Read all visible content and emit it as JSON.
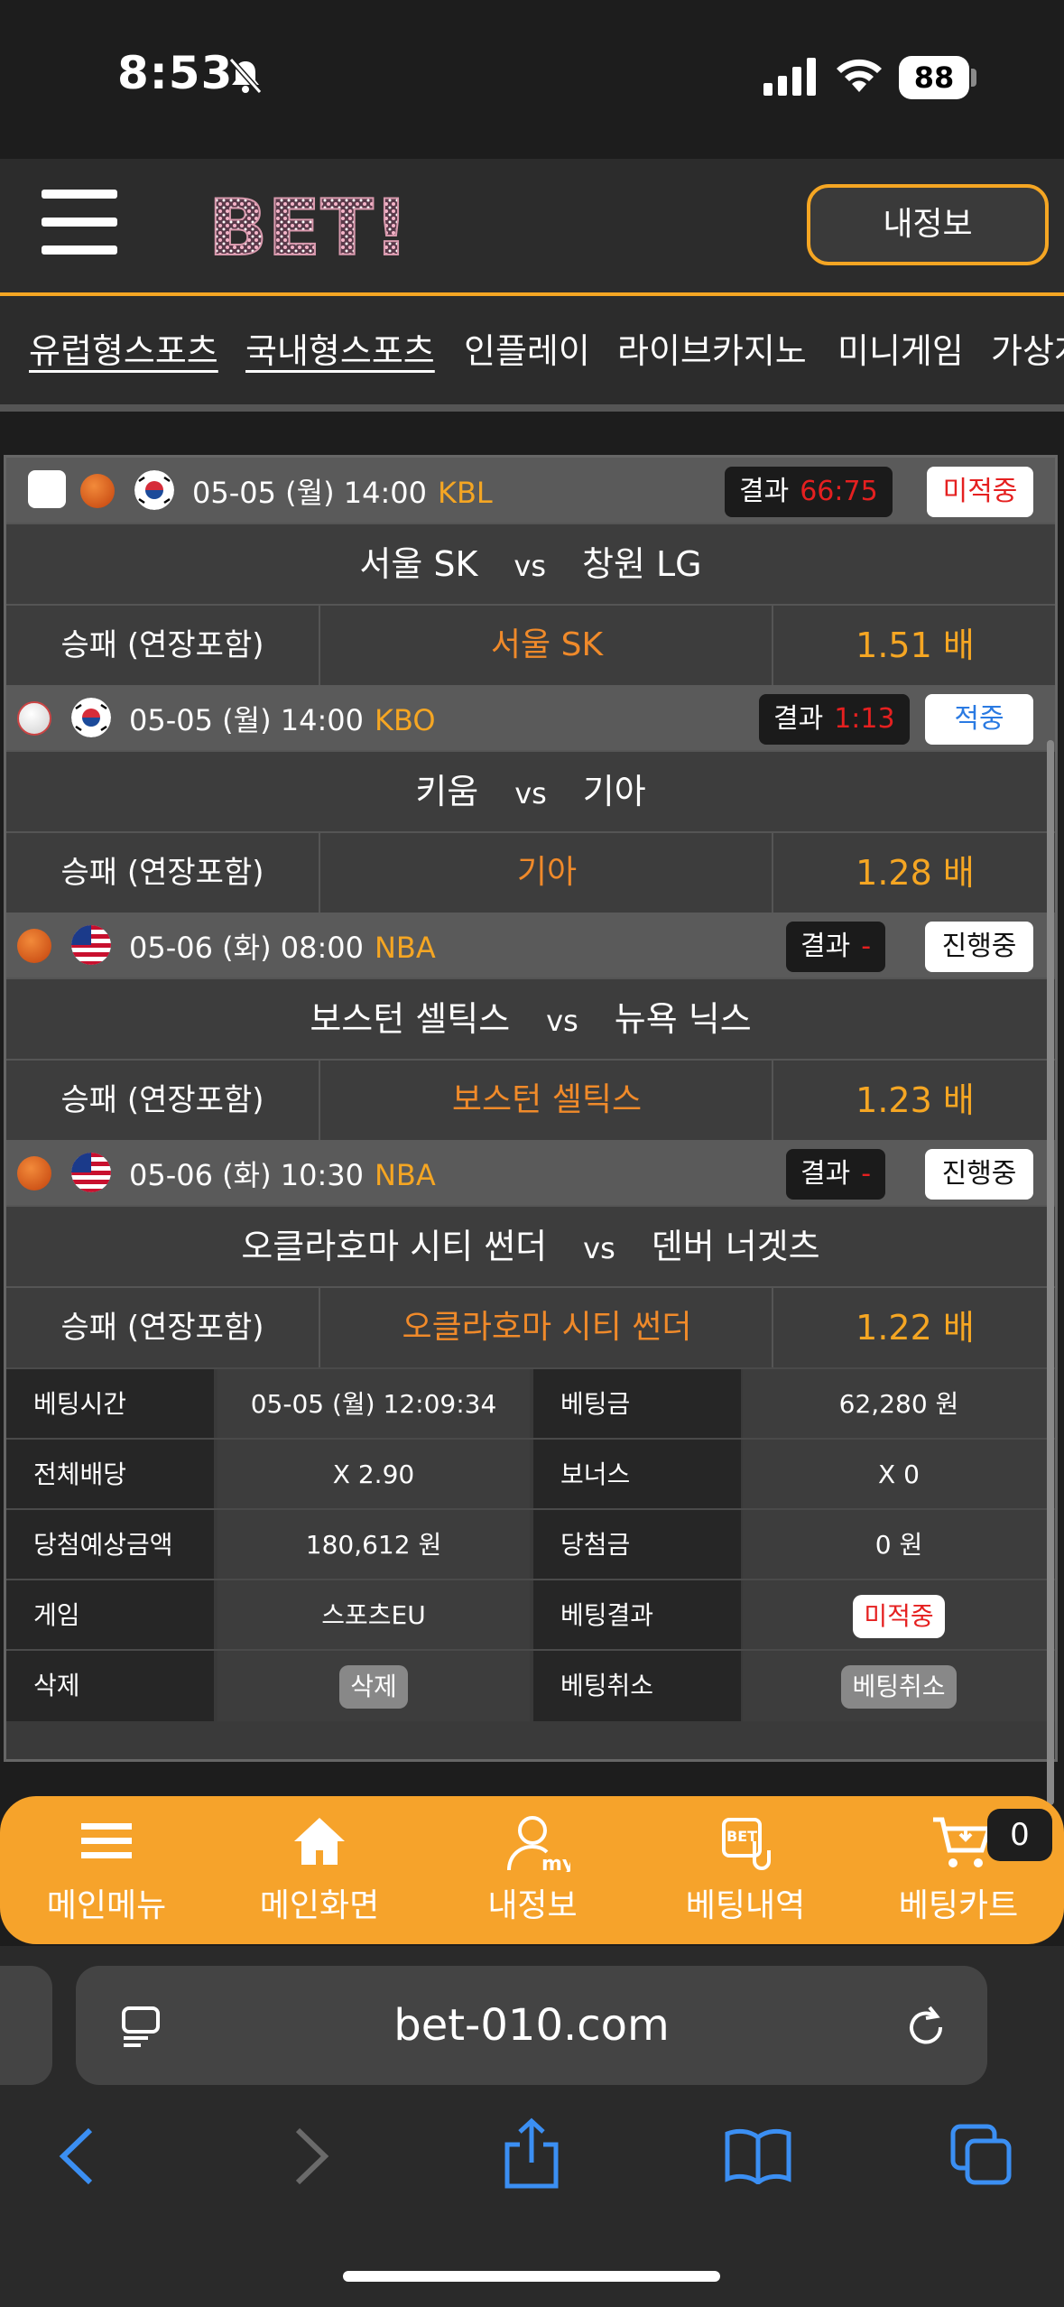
{
  "status_bar": {
    "time": "8:53",
    "battery": "88"
  },
  "header": {
    "logo_text": "BET!",
    "myinfo_label": "내정보"
  },
  "nav": {
    "tabs": [
      {
        "label": "유럽형스포츠"
      },
      {
        "label": "국내형스포츠"
      },
      {
        "label": "인플레이"
      },
      {
        "label": "라이브카지노"
      },
      {
        "label": "미니게임"
      },
      {
        "label": "가상게"
      }
    ]
  },
  "games": [
    {
      "datetime": "05-05 (월) 14:00",
      "league": "KBL",
      "result_label": "결과",
      "score": "66:75",
      "status": "미적중",
      "status_color": "#e52020",
      "home": "서울 SK",
      "vs": "vs",
      "away": "창원 LG",
      "bet_type": "승패 (연장포함)",
      "pick": "서울 SK",
      "odds": "1.51 배"
    },
    {
      "datetime": "05-05 (월) 14:00",
      "league": "KBO",
      "result_label": "결과",
      "score": "1:13",
      "status": "적중",
      "status_color": "#2a7ae2",
      "home": "키움",
      "vs": "vs",
      "away": "기아",
      "bet_type": "승패 (연장포함)",
      "pick": "기아",
      "odds": "1.28 배"
    },
    {
      "datetime": "05-06 (화) 08:00",
      "league": "NBA",
      "result_label": "결과",
      "score": "-",
      "status": "진행중",
      "status_color": "#111111",
      "home": "보스턴 셀틱스",
      "vs": "vs",
      "away": "뉴욕 닉스",
      "bet_type": "승패 (연장포함)",
      "pick": "보스턴 셀틱스",
      "odds": "1.23 배"
    },
    {
      "datetime": "05-06 (화) 10:30",
      "league": "NBA",
      "result_label": "결과",
      "score": "-",
      "status": "진행중",
      "status_color": "#111111",
      "home": "오클라호마 시티 썬더",
      "vs": "vs",
      "away": "덴버 너겟츠",
      "bet_type": "승패 (연장포함)",
      "pick": "오클라호마 시티 썬더",
      "odds": "1.22 배"
    }
  ],
  "summary": {
    "bet_time_k": "베팅시간",
    "bet_time_v": "05-05 (월) 12:09:34",
    "bet_amount_k": "베팅금",
    "bet_amount_v": "62,280 원",
    "total_odds_k": "전체배당",
    "total_odds_v": "X 2.90",
    "bonus_k": "보너스",
    "bonus_v": "X 0",
    "expected_k": "당첨예상금액",
    "expected_v": "180,612 원",
    "won_k": "당첨금",
    "won_v": "0 원",
    "game_k": "게임",
    "game_v": "스포츠EU",
    "result_k": "베팅결과",
    "result_v": "미적중",
    "delete_k": "삭제",
    "delete_btn": "삭제",
    "cancel_k": "베팅취소",
    "cancel_btn": "베팅취소"
  },
  "bottom_menu": {
    "items": [
      {
        "label": "메인메뉴"
      },
      {
        "label": "메인화면"
      },
      {
        "label": "내정보"
      },
      {
        "label": "베팅내역"
      },
      {
        "label": "베팅카트"
      }
    ],
    "cart_count": "0"
  },
  "browser": {
    "url": "bet-010.com"
  }
}
